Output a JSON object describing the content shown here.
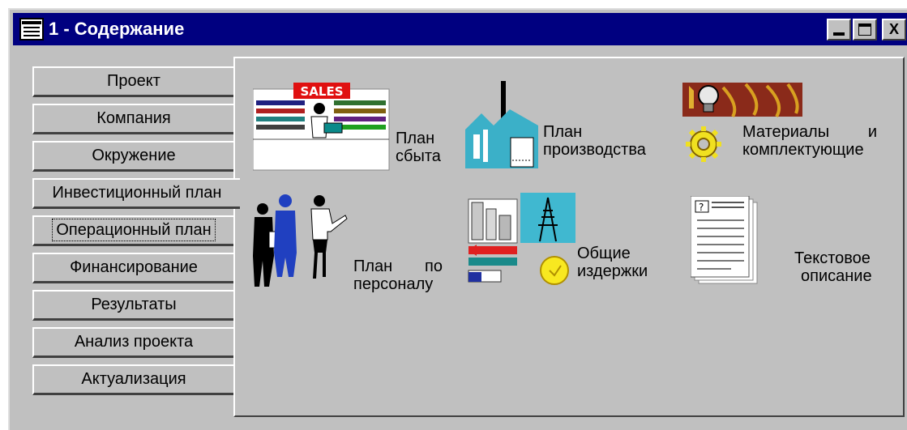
{
  "window": {
    "title": "1 - Содержание",
    "controls": {
      "minimize_icon": "minimize-icon",
      "maximize_icon": "maximize-icon",
      "close_glyph": "X"
    }
  },
  "tabs": [
    {
      "label": "Проект"
    },
    {
      "label": "Компания"
    },
    {
      "label": "Окружение"
    },
    {
      "label": "Инвестиционный план",
      "active": true
    },
    {
      "label": "Операционный план",
      "focused": true
    },
    {
      "label": "Финансирование"
    },
    {
      "label": "Результаты"
    },
    {
      "label": "Анализ проекта"
    },
    {
      "label": "Актуализация"
    }
  ],
  "panel": {
    "items": [
      {
        "id": "sales-plan",
        "line1": "План",
        "line2": "сбыта",
        "icon": "sales-icon",
        "sign_text": "SALES"
      },
      {
        "id": "production-plan",
        "line1": "План",
        "line2": "производства",
        "icon": "factory-icon"
      },
      {
        "id": "materials",
        "line1a": "Материалы",
        "line1b": "и",
        "line2": "комплектующие",
        "icon": "lightbulb-gear-icon"
      },
      {
        "id": "personnel-plan",
        "line1a": "План",
        "line1b": "по",
        "line2": "персоналу",
        "icon": "people-icon"
      },
      {
        "id": "overhead",
        "line1": "Общие",
        "line2": "издержки",
        "icon": "overhead-costs-icon"
      },
      {
        "id": "text-description",
        "line1": "Текстовое",
        "line2": "описание",
        "icon": "document-icon"
      }
    ]
  },
  "colors": {
    "face": "#c0c0c0",
    "titlebar": "#000080",
    "highlight": "#ffffff",
    "shadow": "#404040"
  }
}
